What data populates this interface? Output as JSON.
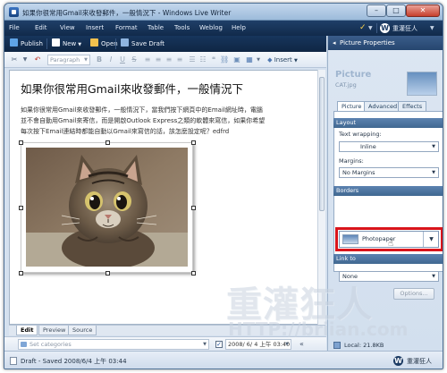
{
  "window": {
    "title": "如果你很常用Gmail來收發郵件，一般情況下 - Windows Live Writer",
    "controls": {
      "minimize": "–",
      "maximize": "□",
      "close": "✕"
    }
  },
  "menu": {
    "items": [
      "File",
      "Edit",
      "View",
      "Insert",
      "Format",
      "Table",
      "Tools",
      "Weblog",
      "Help"
    ],
    "blog_name": "重灌狂人"
  },
  "toolbar": {
    "publish": "Publish",
    "new": "New",
    "open": "Open",
    "save_draft": "Save Draft"
  },
  "format_bar": {
    "paragraph": "Paragraph",
    "insert": "Insert"
  },
  "editor": {
    "title": "如果你很常用Gmail來收發郵件，一般情況下",
    "body_lines": [
      "如果你很常用Gmail來收發郵件，一般情況下，當我們按下網頁中的Email網址時，電腦",
      "並不會自動用Gmail來寄信，而是開啟Outlook Express之類的軟體來寫信，如果你希望",
      "每次按下Email連結時都能自動以Gmail來寫信的話，該怎麼設定呢？edfrd"
    ]
  },
  "view_tabs": [
    "Edit",
    "Preview",
    "Source"
  ],
  "category_bar": {
    "placeholder": "Set categories",
    "date_checked": true,
    "date": "2008/ 6/ 4 上午 03:40"
  },
  "status": {
    "text": "Draft - Saved 2008/6/4 上午 03:44",
    "blog_name": "重灌狂人"
  },
  "panel": {
    "header": "Picture Properties",
    "name": "Picture",
    "file": "CAT.jpg",
    "tabs": [
      "Picture",
      "Advanced",
      "Effects"
    ],
    "sections": {
      "layout": "Layout",
      "borders": "Borders",
      "link_to": "Link to"
    },
    "text_wrapping_label": "Text wrapping:",
    "text_wrapping": "Inline",
    "margins_label": "Margins:",
    "margins": "No Margins",
    "border_style": "Photopaper",
    "link_to": "None",
    "options_button": "Options...",
    "footer": "Local: 21.8KB"
  },
  "watermark": {
    "text": "重灌狂人",
    "url": "HTTP://briian.com"
  },
  "colors": {
    "menu_bar": "#1b3a63",
    "highlight": "#d9141b",
    "panel_section": "#4f76a4"
  }
}
